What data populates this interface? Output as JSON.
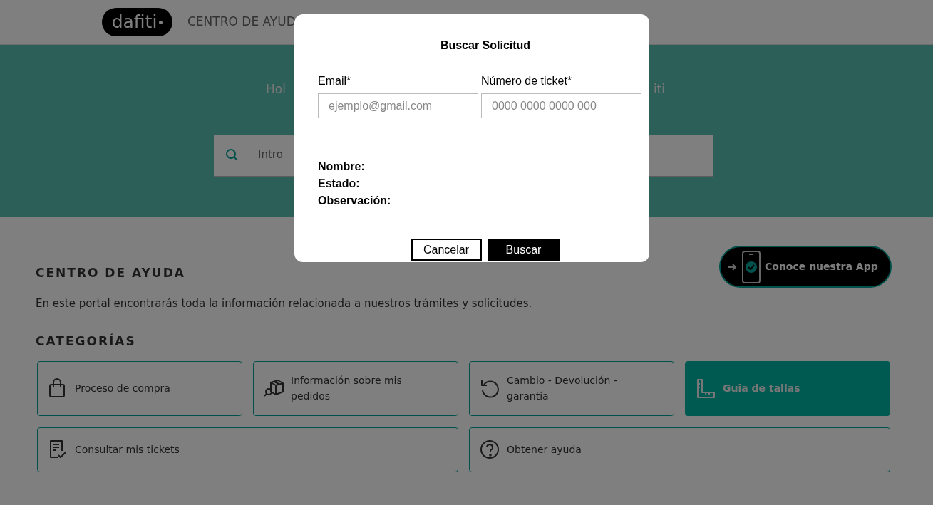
{
  "header": {
    "logo": "dafiti",
    "title": "CENTRO DE AYUD"
  },
  "hero": {
    "heading_start": "Hol",
    "heading_end": "iti",
    "search": {
      "placeholder": "Intro"
    }
  },
  "app_button": {
    "label": "Conoce nuestra App"
  },
  "intro": {
    "title": "CENTRO DE AYUDA",
    "text": "En este portal encontrarás toda la información relacionada a nuestros trámites y solicitudes."
  },
  "categories": {
    "title": "CATEGORÍAS",
    "items": [
      {
        "label": "Proceso de compra",
        "selected": false
      },
      {
        "label": "Información sobre mis pedidos",
        "selected": false
      },
      {
        "label": "Cambio - Devolución - garantía",
        "selected": false
      },
      {
        "label": "Guia de tallas",
        "selected": true
      },
      {
        "label": "Consultar mis tickets",
        "selected": false
      },
      {
        "label": "Obtener ayuda",
        "selected": false
      }
    ]
  },
  "modal": {
    "title": "Buscar Solicitud",
    "fields": [
      {
        "label": "Email*",
        "placeholder": "ejemplo@gmail.com"
      },
      {
        "label": "Número de ticket*",
        "placeholder": "0000 0000 0000 000"
      }
    ],
    "results": [
      "Nombre:",
      "Estado:",
      "Observación:"
    ],
    "buttons": [
      {
        "label": "Cancelar",
        "kind": "secondary"
      },
      {
        "label": "Buscar",
        "kind": "primary"
      }
    ]
  }
}
